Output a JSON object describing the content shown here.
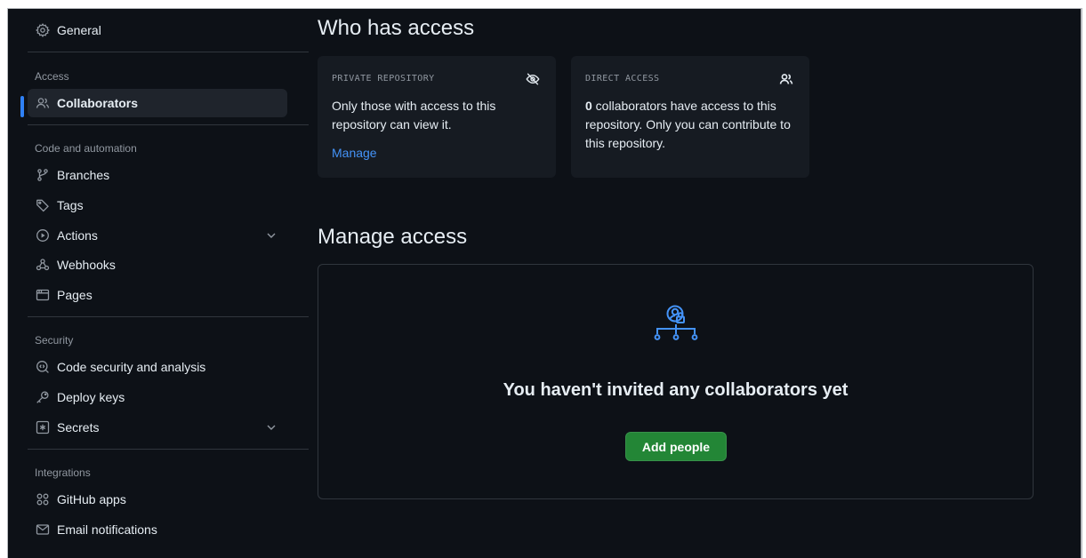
{
  "sidebar": {
    "general": "General",
    "groups": {
      "access": "Access",
      "code_automation": "Code and automation",
      "security": "Security",
      "integrations": "Integrations"
    },
    "items": {
      "collaborators": "Collaborators",
      "branches": "Branches",
      "tags": "Tags",
      "actions": "Actions",
      "webhooks": "Webhooks",
      "pages": "Pages",
      "code_security": "Code security and analysis",
      "deploy_keys": "Deploy keys",
      "secrets": "Secrets",
      "github_apps": "GitHub apps",
      "email_notifications": "Email notifications"
    }
  },
  "main": {
    "who_has_access_title": "Who has access",
    "private_card": {
      "label": "PRIVATE REPOSITORY",
      "description": "Only those with access to this repository can view it.",
      "link": "Manage"
    },
    "direct_card": {
      "label": "DIRECT ACCESS",
      "count": "0",
      "description": " collaborators have access to this repository. Only you can contribute to this repository."
    },
    "manage_access_title": "Manage access",
    "empty_state": {
      "title": "You haven't invited any collaborators yet",
      "button": "Add people"
    }
  },
  "colors": {
    "background": "#0d1117",
    "card": "#161b22",
    "border": "#30363d",
    "accent_blue": "#2f81f7",
    "link_blue": "#4493f8",
    "button_green": "#238636"
  }
}
